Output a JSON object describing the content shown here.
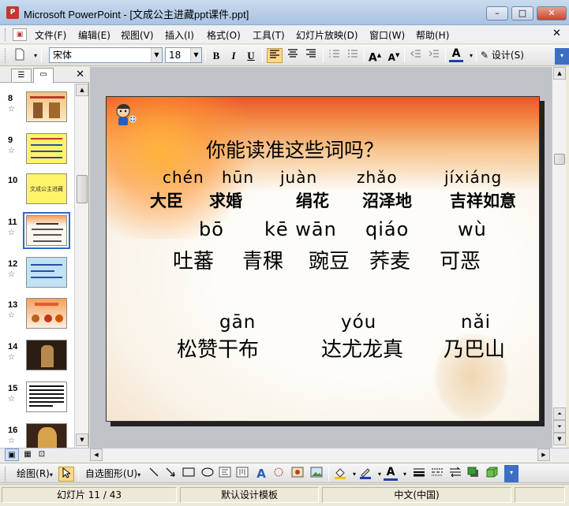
{
  "window": {
    "title": "Microsoft PowerPoint - [文成公主进藏ppt课件.ppt]",
    "minimize": "–",
    "maximize": "□",
    "close": "✕"
  },
  "menu": {
    "items": [
      "文件(F)",
      "编辑(E)",
      "视图(V)",
      "插入(I)",
      "格式(O)",
      "工具(T)",
      "幻灯片放映(D)",
      "窗口(W)",
      "帮助(H)"
    ],
    "close_glyph": "✕"
  },
  "toolbar": {
    "font_name": "宋体",
    "font_size": "18",
    "bold": "B",
    "italic": "I",
    "underline": "U",
    "grow_font": "A",
    "shrink_font": "A",
    "font_color": "A",
    "design_label": "设计(S)"
  },
  "slide_pane": {
    "slides": [
      {
        "num": "8"
      },
      {
        "num": "9"
      },
      {
        "num": "10"
      },
      {
        "num": "11",
        "selected": true
      },
      {
        "num": "12"
      },
      {
        "num": "13"
      },
      {
        "num": "14"
      },
      {
        "num": "15"
      },
      {
        "num": "16"
      }
    ],
    "thumb_text_10": "文成公主进藏"
  },
  "slide": {
    "heading": "你能读准这些词吗？",
    "row1_pinyin": [
      "chén",
      "hūn",
      "juàn",
      "zhǎo",
      "jíxiáng"
    ],
    "row1_words": [
      "大臣",
      "求婚",
      "绢花",
      "沼泽地",
      "吉祥如意"
    ],
    "row2_pinyin": [
      "bō",
      "kē wān",
      "qiáo",
      "wù"
    ],
    "row2_words": [
      "吐蕃",
      "青稞",
      "豌豆",
      "荞麦",
      "可恶"
    ],
    "row3_pinyin": [
      "gān",
      "yóu",
      "nǎi"
    ],
    "row3_words": [
      "松赞干布",
      "达尤龙真",
      "乃巴山"
    ]
  },
  "drawing_toolbar": {
    "draw_label": "绘图(R)",
    "autoshapes_label": "自选图形(U)"
  },
  "status": {
    "slide_info": "幻灯片 11 / 43",
    "template": "默认设计模板",
    "language": "中文(中国)"
  },
  "colors": {
    "titlebar": "#b9cfea",
    "selection": "#316ac5",
    "active_button": "#ffd989"
  }
}
